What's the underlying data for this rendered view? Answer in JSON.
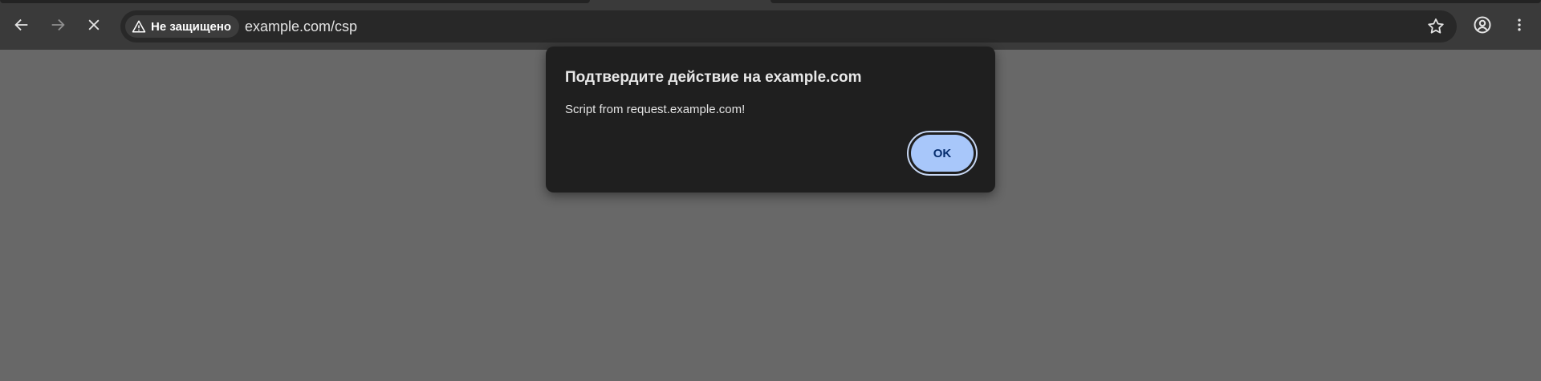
{
  "browser": {
    "security_label": "Не защищено",
    "url": "example.com/csp",
    "icons": {
      "back": "back-arrow-icon",
      "forward": "forward-arrow-icon",
      "stop": "close-icon",
      "warning": "warning-icon",
      "bookmark": "star-icon",
      "profile": "profile-icon",
      "menu": "kebab-menu-icon"
    }
  },
  "dialog": {
    "title": "Подтвердите действие на example.com",
    "message": "Script from request.example.com!",
    "ok_label": "OK"
  },
  "colors": {
    "toolbar": "#3a3a3a",
    "omnibox": "#282828",
    "page_background": "#686868",
    "dialog_background": "#1f1f1f",
    "ok_button": "#a8c7fa",
    "ok_text": "#062e6f"
  }
}
